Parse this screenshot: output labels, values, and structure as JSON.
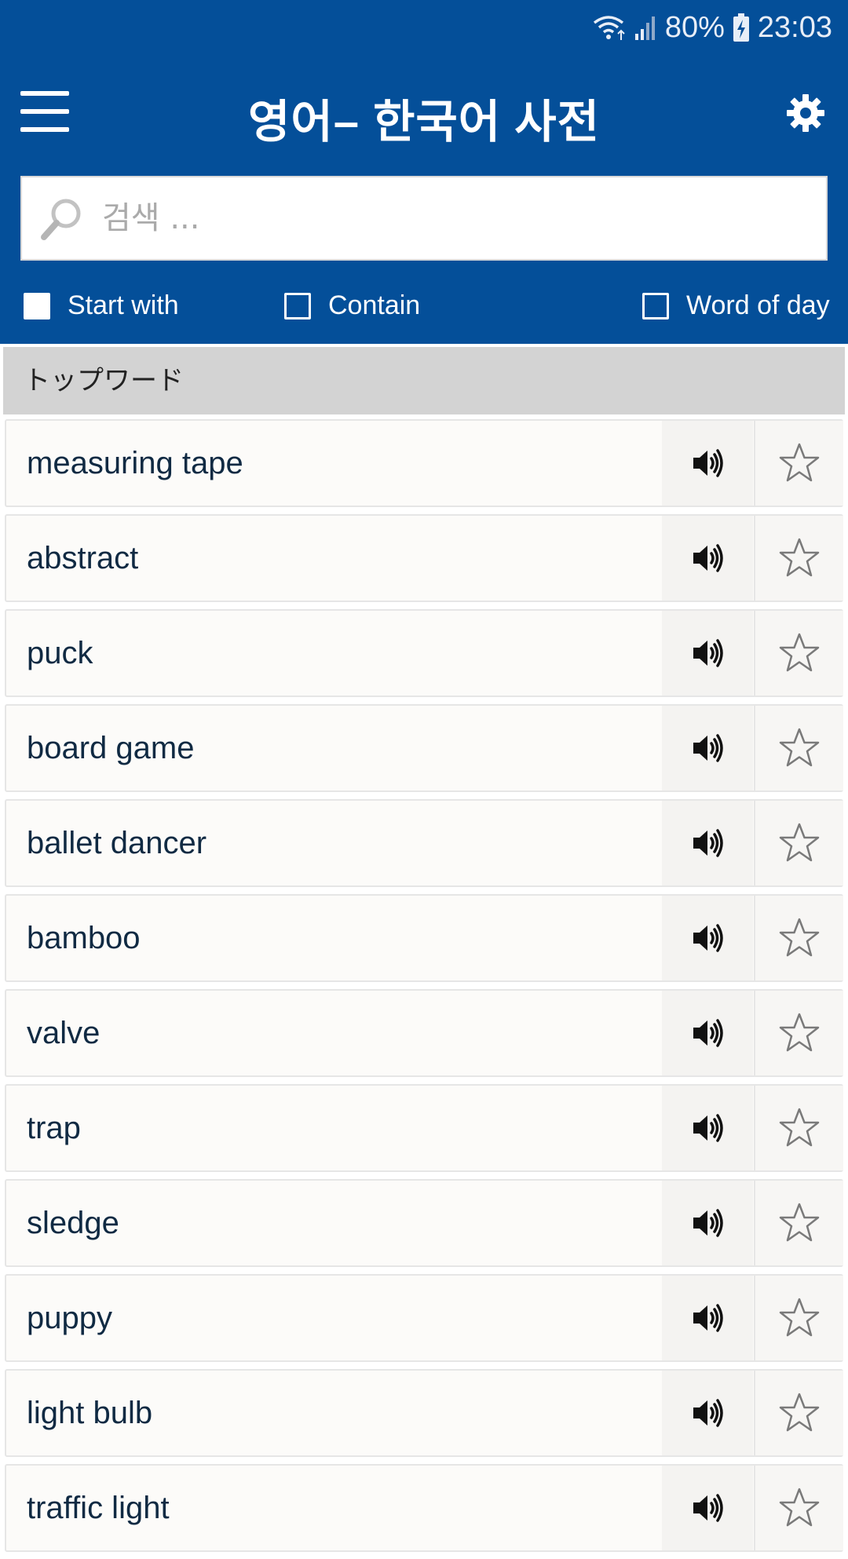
{
  "status_bar": {
    "battery": "80%",
    "time": "23:03"
  },
  "header": {
    "title": "영어– 한국어 사전"
  },
  "search": {
    "placeholder": "검색 ..."
  },
  "filters": {
    "start_with": {
      "label": "Start with",
      "checked": true
    },
    "contain": {
      "label": "Contain",
      "checked": false
    },
    "word_of_day": {
      "label": "Word of day",
      "checked": false
    }
  },
  "section": {
    "title": "トップワード"
  },
  "words": [
    "measuring tape",
    "abstract",
    "puck",
    "board game",
    "ballet dancer",
    "bamboo",
    "valve",
    "trap",
    "sledge",
    "puppy",
    "light bulb",
    "traffic light"
  ],
  "colors": {
    "header_bg": "#044f99",
    "section_bg": "#d3d3d3",
    "row_bg": "#fcfbf9",
    "word_text": "#102a43"
  },
  "icons": {
    "menu": "hamburger-menu-icon",
    "settings": "gear-icon",
    "search": "magnifier-icon",
    "speak": "speaker-icon",
    "favorite": "star-outline-icon"
  }
}
